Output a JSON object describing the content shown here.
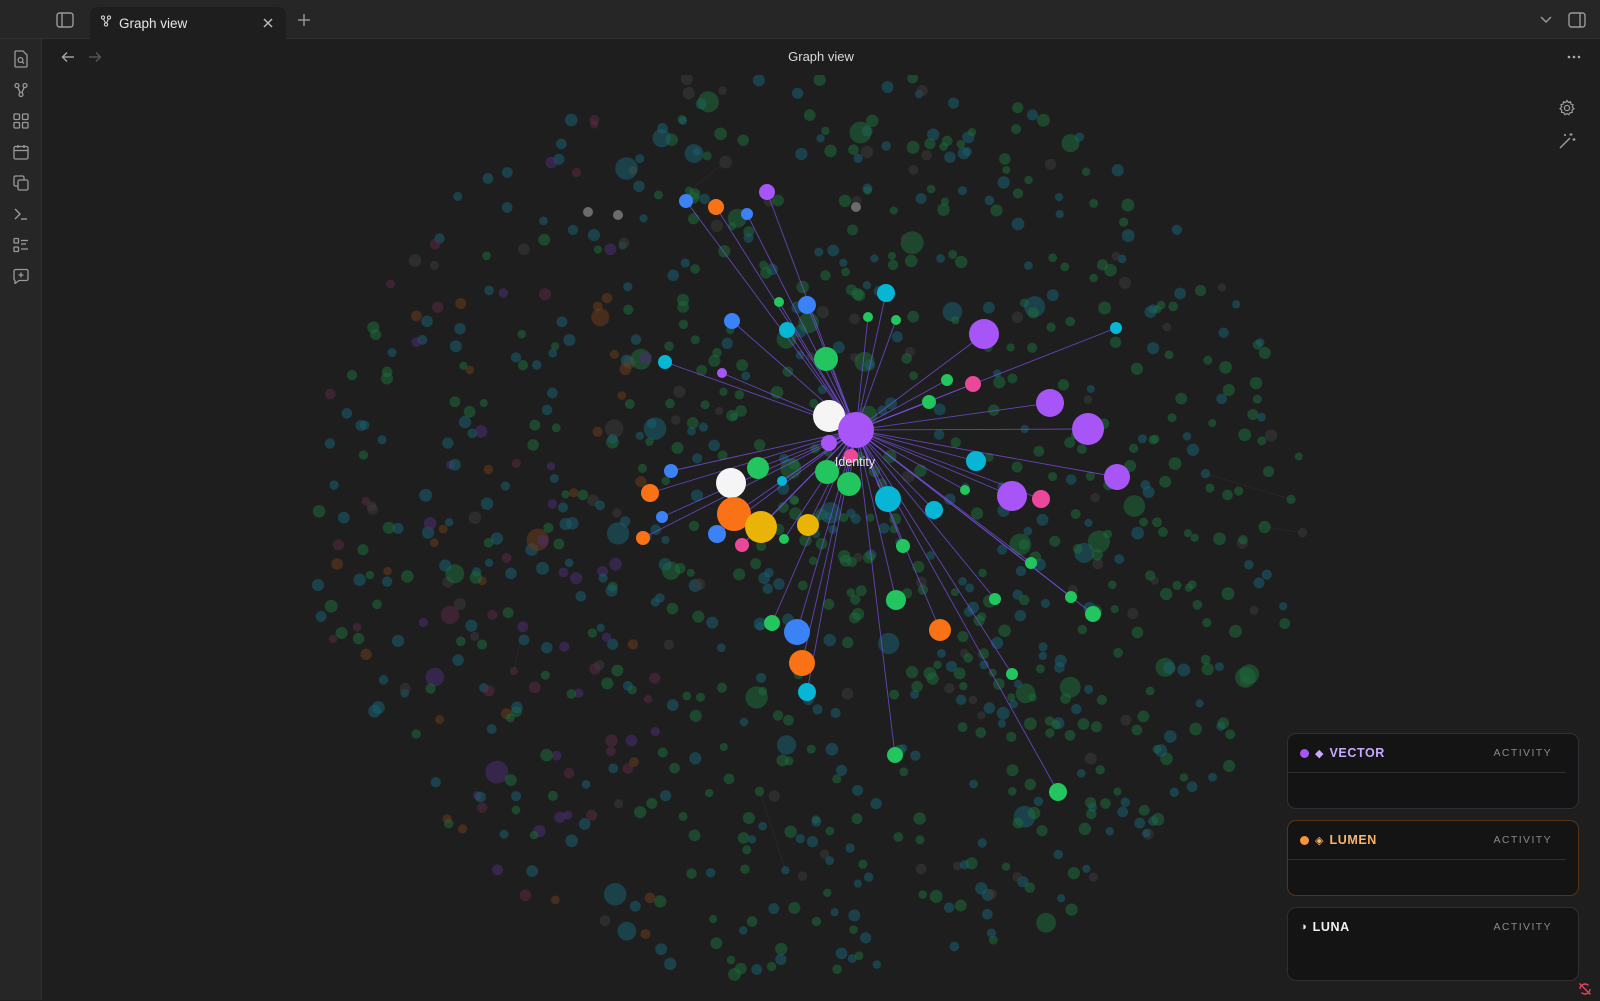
{
  "app": {
    "tab": {
      "label": "Graph view",
      "icon": "graph-icon"
    },
    "view_title": "Graph view"
  },
  "ribbon": {
    "items": [
      {
        "name": "file-search-icon"
      },
      {
        "name": "graph-icon"
      },
      {
        "name": "grid-icon"
      },
      {
        "name": "calendar-icon"
      },
      {
        "name": "copy-icon"
      },
      {
        "name": "terminal-icon"
      },
      {
        "name": "checklist-icon"
      },
      {
        "name": "comment-plus-icon"
      }
    ]
  },
  "graph": {
    "hub_label": "Identity",
    "edge_color": "#7b52e8",
    "background_node_colors": [
      "#1d6b3c",
      "#1a5f70",
      "#6a3b19",
      "#4d2d73",
      "#5a2a45",
      "#3a3a3a"
    ],
    "highlighted_colors": {
      "green": "#22c55e",
      "cyan": "#06b6d4",
      "blue": "#3b82f6",
      "purple": "#a855f7",
      "orange": "#f97316",
      "pink": "#ec4899",
      "yellow": "#eab308",
      "white": "#f5f5f5",
      "gray": "#6b6b6b"
    }
  },
  "panels": [
    {
      "name": "VECTOR",
      "glyph": "◆",
      "activity_label": "ACTIVITY",
      "dot_color": "#a855f7",
      "color": "#c9a8ff",
      "border": "#2f2f38"
    },
    {
      "name": "LUMEN",
      "glyph": "◈",
      "activity_label": "ACTIVITY",
      "dot_color": "#fb923c",
      "color": "#fbb46b",
      "border": "#5a3412"
    },
    {
      "name": "LUNA",
      "glyph": "◑",
      "activity_label": "ACTIVITY",
      "dot_color": "",
      "color": "#f2f2f2",
      "border": "#2f2f2f"
    }
  ]
}
